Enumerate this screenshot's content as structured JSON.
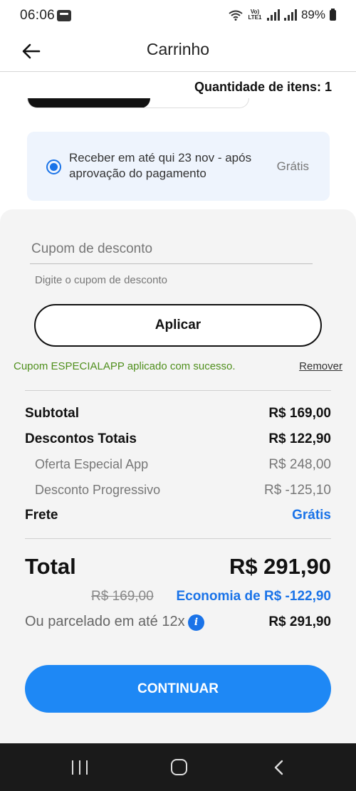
{
  "status_bar": {
    "time": "06:06",
    "network_label": "Vo) LTE1",
    "battery": "89%"
  },
  "header": {
    "title": "Carrinho",
    "back_icon": "arrow-left-icon"
  },
  "cart": {
    "quantity_text": "Quantidade de itens: 1"
  },
  "delivery": {
    "option_text": "Receber em até qui 23 nov - após aprovação do pagamento",
    "price": "Grátis",
    "accent_color": "#1a73e8"
  },
  "coupon": {
    "placeholder": "Cupom de desconto",
    "value": "",
    "helper": "Digite o cupom de desconto",
    "apply_label": "Aplicar",
    "success_message": "Cupom ESPECIALAPP aplicado com sucesso.",
    "remove_label": "Remover",
    "success_color": "#4f8f1c"
  },
  "summary": {
    "subtotal_label": "Subtotal",
    "subtotal_value": "R$ 169,00",
    "discounts_label": "Descontos Totais",
    "discounts_value": "R$ 122,90",
    "special_offer_label": "Oferta Especial App",
    "special_offer_value": "R$ 248,00",
    "progressive_label": "Desconto Progressivo",
    "progressive_value": "R$ -125,10",
    "shipping_label": "Frete",
    "shipping_value": "Grátis",
    "total_label": "Total",
    "total_value": "R$ 291,90",
    "old_price": "R$ 169,00",
    "savings": "Economia de R$ -122,90",
    "installment_label": "Ou parcelado em até 12x",
    "installment_value": "R$ 291,90",
    "info_icon": "info-icon"
  },
  "actions": {
    "continue_label": "CONTINUAR",
    "button_color": "#1e88f5"
  },
  "nav": {
    "recent_icon": "recent-apps-icon",
    "home_icon": "home-icon",
    "back_icon": "back-icon"
  }
}
